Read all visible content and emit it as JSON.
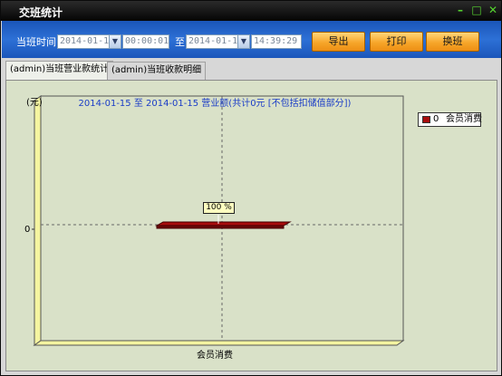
{
  "window": {
    "title": "交班统计",
    "controls": {
      "minimize": "–",
      "maximize": "□",
      "close": "✕"
    }
  },
  "toolbar": {
    "time_label": "当班时间：",
    "start_date": "2014-01-15",
    "start_time": "00:00:01",
    "to_label": "至",
    "end_date": "2014-01-15",
    "end_time": "14:39:29",
    "export_label": "导出",
    "print_label": "打印",
    "handover_label": "换班"
  },
  "tabs": [
    {
      "label": "(admin)当班营业款统计",
      "active": true
    },
    {
      "label": "(admin)当班收款明细",
      "active": false
    }
  ],
  "colors": {
    "toolbar": "#2d70d6",
    "button": "#f7a62a",
    "series": "#a80d0d",
    "chart_bg": "#d9e1c8",
    "wall": "#f4f4a0"
  },
  "chart_data": {
    "type": "bar",
    "title": "2014-01-15 至 2014-01-15 营业额(共计0元 [不包括扣储值部分])",
    "ylabel": "(元)",
    "xlabel": "",
    "categories": [
      "会员消费"
    ],
    "series": [
      {
        "name": "会员消费",
        "values": [
          0
        ]
      }
    ],
    "legend": {
      "position": "top-right",
      "value": "0",
      "name": "会员消费"
    },
    "data_labels": [
      "100 %"
    ],
    "yticks": [
      "0"
    ],
    "grid": true
  }
}
